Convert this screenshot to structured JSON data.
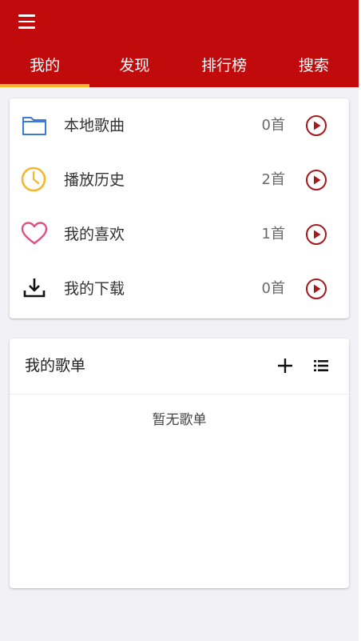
{
  "colors": {
    "appbar": "#c00a0b",
    "tab_indicator": "#f5b72b",
    "play_accent": "#a31a1e"
  },
  "header": {
    "menu_icon": "menu-icon"
  },
  "tabs": [
    {
      "label": "我的",
      "active": true
    },
    {
      "label": "发现",
      "active": false
    },
    {
      "label": "排行榜",
      "active": false
    },
    {
      "label": "搜索",
      "active": false
    }
  ],
  "library": [
    {
      "icon": "folder-icon",
      "label": "本地歌曲",
      "count": "0首"
    },
    {
      "icon": "clock-icon",
      "label": "播放历史",
      "count": "2首"
    },
    {
      "icon": "heart-icon",
      "label": "我的喜欢",
      "count": "1首"
    },
    {
      "icon": "download-icon",
      "label": "我的下载",
      "count": "0首"
    }
  ],
  "playlists": {
    "title": "我的歌单",
    "add_icon": "plus-icon",
    "list_icon": "list-icon",
    "empty_text": "暂无歌单"
  }
}
